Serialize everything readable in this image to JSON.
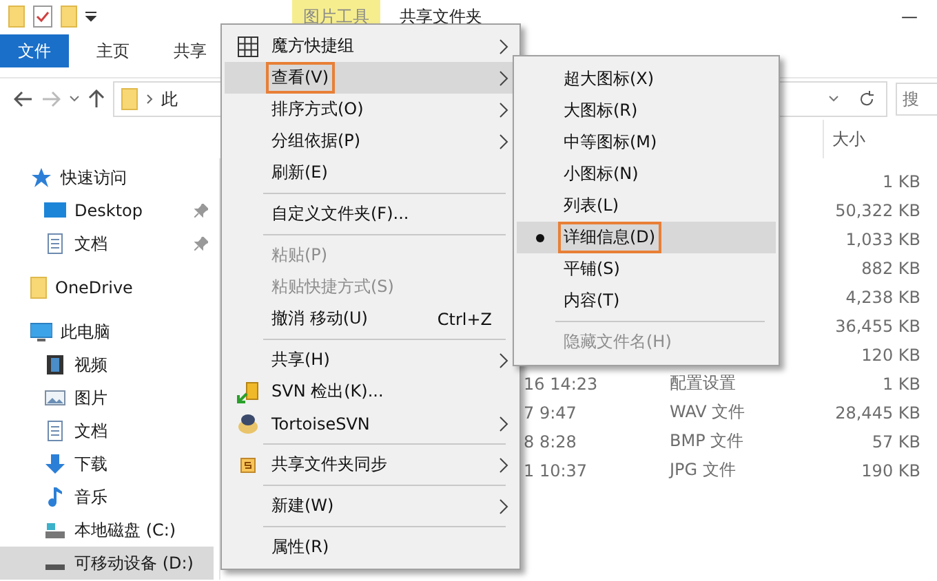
{
  "title_bar": {
    "context_tab": "图片工具",
    "title": "共享文件夹",
    "minimize": "—"
  },
  "ribbon_tabs": [
    {
      "label": "文件",
      "selected": true
    },
    {
      "label": "主页",
      "selected": false
    },
    {
      "label": "共享",
      "selected": false
    }
  ],
  "address_bar": {
    "path_start": "此"
  },
  "search": {
    "placeholder": "搜"
  },
  "columns": {
    "size": "大小"
  },
  "sidebar": [
    {
      "label": "快速访问",
      "kind": "star",
      "selected": false,
      "children": [
        {
          "label": "Desktop",
          "kind": "desktop",
          "pinned": true,
          "selected": false
        },
        {
          "label": "文档",
          "kind": "document",
          "pinned": true,
          "selected": false
        }
      ]
    },
    {
      "label": "OneDrive",
      "kind": "folder",
      "selected": false
    },
    {
      "label": "此电脑",
      "kind": "computer",
      "selected": false,
      "children": [
        {
          "label": "视频",
          "kind": "video",
          "selected": false
        },
        {
          "label": "图片",
          "kind": "picture",
          "selected": false
        },
        {
          "label": "文档",
          "kind": "document",
          "selected": false
        },
        {
          "label": "下载",
          "kind": "download",
          "selected": false
        },
        {
          "label": "音乐",
          "kind": "music",
          "selected": false
        },
        {
          "label": "本地磁盘 (C:)",
          "kind": "disk",
          "selected": false
        },
        {
          "label": "可移动设备 (D:)",
          "kind": "drive",
          "selected": true
        }
      ]
    }
  ],
  "rows": [
    {
      "size": "1 KB"
    },
    {
      "size": "50,322 KB"
    },
    {
      "size": "1,033 KB"
    },
    {
      "size": "882 KB"
    },
    {
      "size": "4,238 KB"
    },
    {
      "size": "36,455 KB"
    },
    {
      "size": "120 KB"
    },
    {
      "date": "16 14:23",
      "type": "配置设置",
      "size": "1 KB"
    },
    {
      "date": "7 9:47",
      "type": "WAV 文件",
      "size": "28,445 KB"
    },
    {
      "date": "8 8:28",
      "type": "BMP 文件",
      "size": "57 KB"
    },
    {
      "date": "1 10:37",
      "type": "JPG 文件",
      "size": "190 KB"
    }
  ],
  "context_menu": [
    {
      "kind": "grid",
      "label": "魔方快捷组",
      "submenu": true,
      "highlighted": false,
      "annotated": false,
      "disabled": false
    },
    {
      "kind": "plain",
      "label": "查看(V)",
      "submenu": true,
      "highlighted": true,
      "annotated": true,
      "disabled": false
    },
    {
      "kind": "plain",
      "label": "排序方式(O)",
      "submenu": true,
      "highlighted": false,
      "annotated": false,
      "disabled": false
    },
    {
      "kind": "plain",
      "label": "分组依据(P)",
      "submenu": true,
      "highlighted": false,
      "annotated": false,
      "disabled": false
    },
    {
      "kind": "plain",
      "label": "刷新(E)",
      "submenu": false,
      "highlighted": false,
      "annotated": false,
      "disabled": false
    },
    {
      "kind": "separator"
    },
    {
      "kind": "plain",
      "label": "自定义文件夹(F)...",
      "submenu": false,
      "highlighted": false,
      "annotated": false,
      "disabled": false
    },
    {
      "kind": "separator"
    },
    {
      "kind": "plain",
      "label": "粘贴(P)",
      "submenu": false,
      "highlighted": false,
      "annotated": false,
      "disabled": true
    },
    {
      "kind": "plain",
      "label": "粘贴快捷方式(S)",
      "submenu": false,
      "highlighted": false,
      "annotated": false,
      "disabled": true
    },
    {
      "kind": "plain",
      "label": "撤消 移动(U)",
      "shortcut": "Ctrl+Z",
      "submenu": false,
      "highlighted": false,
      "annotated": false,
      "disabled": false
    },
    {
      "kind": "separator"
    },
    {
      "kind": "plain",
      "label": "共享(H)",
      "submenu": true,
      "highlighted": false,
      "annotated": false,
      "disabled": false
    },
    {
      "kind": "checkout",
      "label": "SVN 检出(K)...",
      "submenu": false,
      "highlighted": false,
      "annotated": false,
      "disabled": false
    },
    {
      "kind": "turtle",
      "label": "TortoiseSVN",
      "submenu": true,
      "highlighted": false,
      "annotated": false,
      "disabled": false
    },
    {
      "kind": "separator"
    },
    {
      "kind": "sync",
      "label": "共享文件夹同步",
      "submenu": true,
      "highlighted": false,
      "annotated": false,
      "disabled": false
    },
    {
      "kind": "separator"
    },
    {
      "kind": "plain",
      "label": "新建(W)",
      "submenu": true,
      "highlighted": false,
      "annotated": false,
      "disabled": false
    },
    {
      "kind": "separator"
    },
    {
      "kind": "plain",
      "label": "属性(R)",
      "submenu": false,
      "highlighted": false,
      "annotated": false,
      "disabled": false
    }
  ],
  "view_submenu": [
    {
      "kind": "item",
      "label": "超大图标(X)",
      "selected": false,
      "highlighted": false,
      "annotated": false,
      "disabled": false
    },
    {
      "kind": "item",
      "label": "大图标(R)",
      "selected": false,
      "highlighted": false,
      "annotated": false,
      "disabled": false
    },
    {
      "kind": "item",
      "label": "中等图标(M)",
      "selected": false,
      "highlighted": false,
      "annotated": false,
      "disabled": false
    },
    {
      "kind": "item",
      "label": "小图标(N)",
      "selected": false,
      "highlighted": false,
      "annotated": false,
      "disabled": false
    },
    {
      "kind": "item",
      "label": "列表(L)",
      "selected": false,
      "highlighted": false,
      "annotated": false,
      "disabled": false
    },
    {
      "kind": "item",
      "label": "详细信息(D)",
      "selected": true,
      "highlighted": true,
      "annotated": true,
      "disabled": false
    },
    {
      "kind": "item",
      "label": "平铺(S)",
      "selected": false,
      "highlighted": false,
      "annotated": false,
      "disabled": false
    },
    {
      "kind": "item",
      "label": "内容(T)",
      "selected": false,
      "highlighted": false,
      "annotated": false,
      "disabled": false
    },
    {
      "kind": "separator"
    },
    {
      "kind": "item",
      "label": "隐藏文件名(H)",
      "selected": false,
      "highlighted": false,
      "annotated": false,
      "disabled": true
    }
  ]
}
